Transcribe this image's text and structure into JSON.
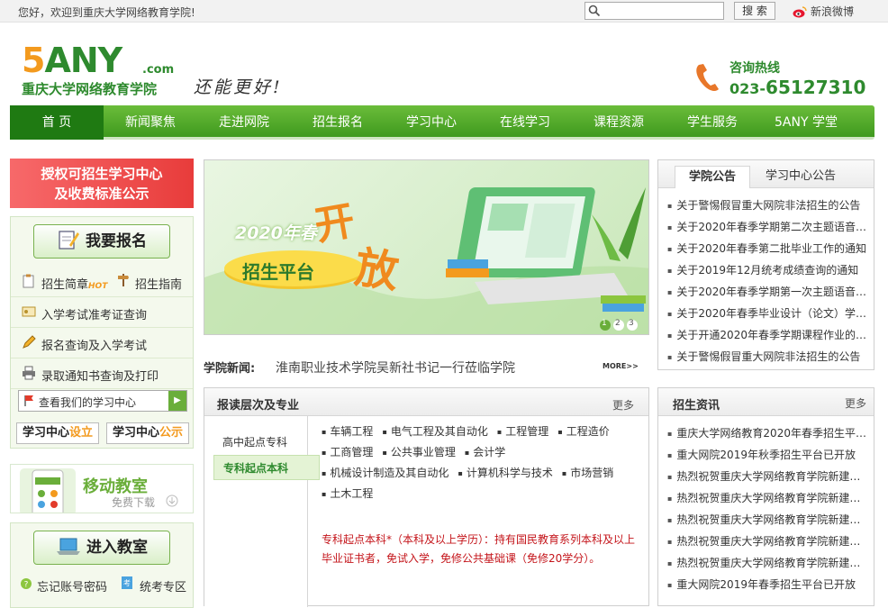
{
  "topbar": {
    "welcome": "您好，欢迎到重庆大学网络教育学院!",
    "search_placeholder": "",
    "search_button": "搜 索",
    "weibo": "新浪微博"
  },
  "header": {
    "logo_5": "5",
    "logo_any": "ANY",
    "logo_com": ".com",
    "logo_name": "重庆大学网络教育学院",
    "slogan": "还能更好!",
    "hotline_label": "咨询热线",
    "hotline_prefix": "023-",
    "hotline_number": "65127310"
  },
  "nav": {
    "items": [
      "首 页",
      "新闻聚焦",
      "走进网院",
      "招生报名",
      "学习中心",
      "在线学习",
      "课程资源",
      "学生服务",
      "5ANY 学堂"
    ]
  },
  "left": {
    "auth_line1": "授权可招生学习中心",
    "auth_line2": "及收费标准公示",
    "signup_button": "我要报名",
    "brochure": "招生简章",
    "hot": "HOT",
    "guide": "招生指南",
    "admit_ticket": "入学考试准考证查询",
    "signup_query": "报名查询及入学考试",
    "notice_query": "录取通知书查询及打印",
    "view_centers": "查看我们的学习中心",
    "center_setup_a": "学习中心",
    "center_setup_b": "设立",
    "center_public_a": "学习中心",
    "center_public_b": "公示",
    "mobile_title": "移动教室",
    "mobile_sub": "免费下载",
    "enter_classroom": "进入教室",
    "forgot": "忘记账号密码",
    "exam_zone": "统考专区"
  },
  "banner": {
    "year": "2020年春",
    "platform": "招生平台",
    "big1": "开",
    "big2": "放",
    "pages": [
      "1",
      "2",
      "3"
    ]
  },
  "college_news": {
    "label": "学院新闻:",
    "text": "淮南职业技术学院吴新社书记一行莅临学院",
    "more": "MORE>>"
  },
  "notice": {
    "tab1": "学院公告",
    "tab2": "学习中心公告",
    "items": [
      "关于警惕假冒重大网院非法招生的公告",
      "关于2020年春季学期第二次主题语音…",
      "关于2020年春季第二批毕业工作的通知",
      "关于2019年12月统考成绩查询的通知",
      "关于2020年春季学期第一次主题语音…",
      "关于2020年春季毕业设计（论文）学…",
      "关于开通2020年春季学期课程作业的…",
      "关于警惕假冒重大网院非法招生的公告"
    ]
  },
  "majors_box": {
    "title": "报读层次及专业",
    "more": "更多",
    "level1": "高中起点专科",
    "level2": "专科起点本科",
    "majors": [
      "车辆工程",
      "电气工程及其自动化",
      "工程管理",
      "工程造价",
      "工商管理",
      "公共事业管理",
      "会计学",
      "机械设计制造及其自动化",
      "计算机科学与技术",
      "市场营销",
      "土木工程"
    ],
    "note": "专科起点本科*（本科及以上学历）：持有国民教育系列本科及以上毕业证书者，免试入学，免修公共基础课（免修20学分）。"
  },
  "recruit": {
    "title": "招生资讯",
    "more": "更多",
    "items": [
      "重庆大学网络教育2020年春季招生平…",
      "重大网院2019年秋季招生平台已开放",
      "热烈祝贺重庆大学网络教育学院新建…",
      "热烈祝贺重庆大学网络教育学院新建…",
      "热烈祝贺重庆大学网络教育学院新建…",
      "热烈祝贺重庆大学网络教育学院新建…",
      "热烈祝贺重庆大学网络教育学院新建…",
      "重大网院2019年春季招生平台已开放"
    ]
  },
  "colors": {
    "brand_green": "#3f9a1e",
    "brand_orange": "#f39a1e",
    "note_red": "#c4141a"
  }
}
